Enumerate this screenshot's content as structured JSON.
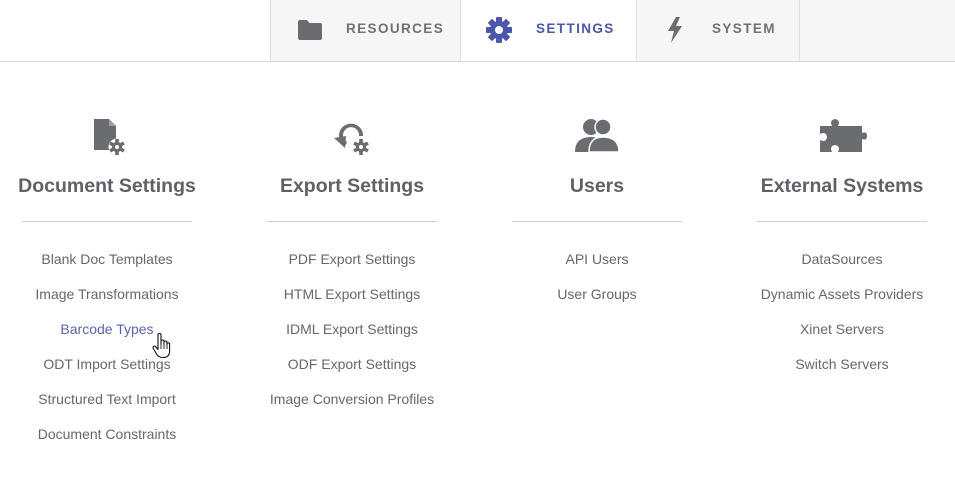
{
  "nav": {
    "tabs": [
      {
        "label": "RESOURCES",
        "icon": "folder-icon",
        "active": false
      },
      {
        "label": "SETTINGS",
        "icon": "gear-icon",
        "active": true
      },
      {
        "label": "SYSTEM",
        "icon": "lightning-icon",
        "active": false
      }
    ]
  },
  "colors": {
    "accent": "#4b57a8",
    "icon_gray": "#6a6c70",
    "text": "#5f6166"
  },
  "columns": [
    {
      "title": "Document Settings",
      "icon": "document-gear-icon",
      "links": [
        "Blank Doc Templates",
        "Image Transformations",
        "Barcode Types",
        "ODT Import Settings",
        "Structured Text Import",
        "Document Constraints"
      ]
    },
    {
      "title": "Export Settings",
      "icon": "export-gear-icon",
      "links": [
        "PDF Export Settings",
        "HTML Export Settings",
        "IDML Export Settings",
        "ODF Export Settings",
        "Image Conversion Profiles"
      ]
    },
    {
      "title": "Users",
      "icon": "users-icon",
      "links": [
        "API Users",
        "User Groups"
      ]
    },
    {
      "title": "External Systems",
      "icon": "puzzle-piece-icon",
      "links": [
        "DataSources",
        "Dynamic Assets Providers",
        "Xinet Servers",
        "Switch Servers"
      ]
    }
  ]
}
